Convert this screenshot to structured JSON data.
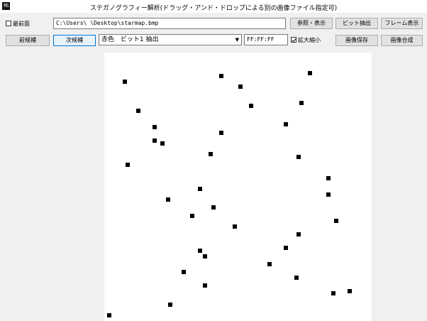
{
  "window": {
    "title": "ステガノグラフィー解析(ドラッグ・アンド・ドロップによる別の画像ファイル指定可)",
    "icon_text": "RS"
  },
  "toolbar": {
    "topmost_label": "最前面",
    "topmost_checked": false,
    "prev_candidate": "前候補",
    "next_candidate": "次候補",
    "path_value": "C:\\Users\\          \\Desktop\\starmap.bmp",
    "browse_button": "参照・表示",
    "extract_bits_button": "ビット抽出",
    "frame_view_button": "フレーム表示",
    "mode_select_value": "赤色　ビット1 抽出",
    "color_value": "FF:FF:FF",
    "zoom_label": "拡大縮小",
    "zoom_checked": true,
    "save_image_button": "画像保存",
    "compose_image_button": "画像合成"
  },
  "image_view": {
    "background": "#ffffff",
    "dot_color": "#000000",
    "dots": [
      [
        0.07,
        0.1
      ],
      [
        0.43,
        0.08
      ],
      [
        0.5,
        0.12
      ],
      [
        0.76,
        0.07
      ],
      [
        0.12,
        0.21
      ],
      [
        0.54,
        0.19
      ],
      [
        0.73,
        0.18
      ],
      [
        0.18,
        0.27
      ],
      [
        0.43,
        0.29
      ],
      [
        0.67,
        0.26
      ],
      [
        0.18,
        0.32
      ],
      [
        0.21,
        0.33
      ],
      [
        0.39,
        0.37
      ],
      [
        0.72,
        0.38
      ],
      [
        0.08,
        0.41
      ],
      [
        0.83,
        0.46
      ],
      [
        0.35,
        0.5
      ],
      [
        0.83,
        0.52
      ],
      [
        0.23,
        0.54
      ],
      [
        0.4,
        0.57
      ],
      [
        0.32,
        0.6
      ],
      [
        0.86,
        0.62
      ],
      [
        0.48,
        0.64
      ],
      [
        0.72,
        0.67
      ],
      [
        0.67,
        0.72
      ],
      [
        0.35,
        0.73
      ],
      [
        0.37,
        0.75
      ],
      [
        0.61,
        0.78
      ],
      [
        0.29,
        0.81
      ],
      [
        0.71,
        0.83
      ],
      [
        0.37,
        0.86
      ],
      [
        0.85,
        0.89
      ],
      [
        0.91,
        0.88
      ],
      [
        0.24,
        0.93
      ],
      [
        0.01,
        0.97
      ]
    ]
  }
}
